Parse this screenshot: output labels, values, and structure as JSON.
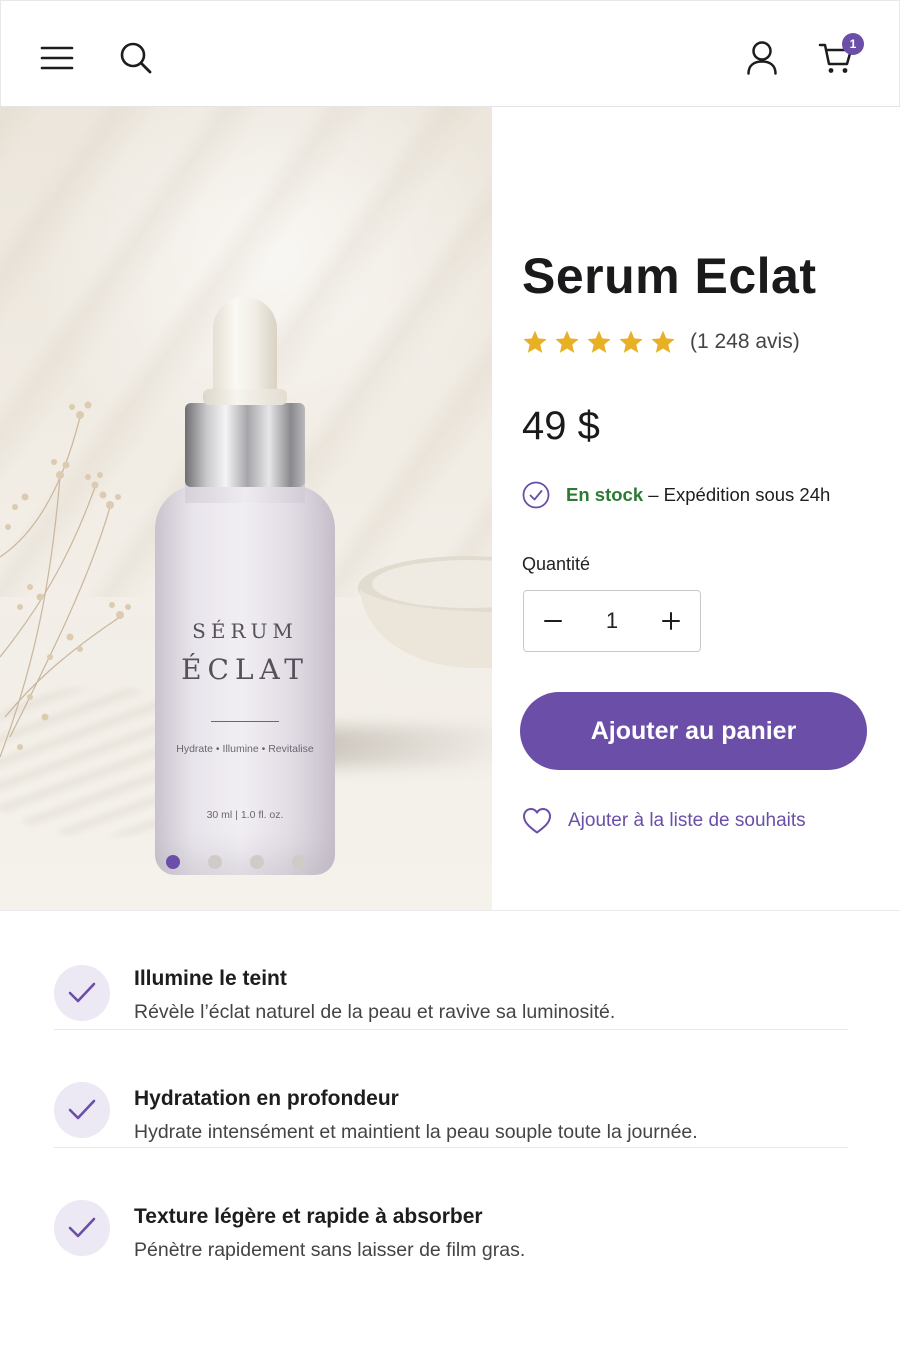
{
  "header": {
    "menu_icon": "hamburger-menu-icon",
    "search_icon": "search-icon",
    "account_icon": "user-icon",
    "cart_icon": "cart-icon",
    "cart_count": "1"
  },
  "gallery": {
    "product_image": "serum-bottle-photo",
    "bottle_label": {
      "line1": "SÉRUM",
      "line2": "ÉCLAT",
      "benefits": "Hydrate • Illumine • Revitalise",
      "volume": "30 ml | 1.0 fl. oz."
    },
    "slides_total": 4,
    "active_slide": 1
  },
  "product": {
    "title": "Serum Eclat",
    "rating": 5,
    "review_count": "(1 248 avis)",
    "price": "49 $",
    "stock_status": "En stock",
    "stock_detail": "– Expédition sous 24h",
    "quantity_label": "Quantité",
    "quantity": "1",
    "add_to_cart_label": "Ajouter au panier",
    "wishlist_label": "Ajouter à la liste de souhaits"
  },
  "features": [
    {
      "title": "Illumine le teint",
      "description": "Révèle l’éclat naturel de la peau et ravive sa luminosité."
    },
    {
      "title": "Hydratation en profondeur",
      "description": "Hydrate intensément et maintient la peau souple toute la journée."
    },
    {
      "title": "Texture légère et rapide à absorber",
      "description": "Pénètre rapidement sans laisser de film gras."
    }
  ],
  "colors": {
    "accent": "#6a4ea8",
    "star": "#e9b026",
    "stock_green": "#2c7a34",
    "feature_icon_bg": "#ece8f4"
  }
}
